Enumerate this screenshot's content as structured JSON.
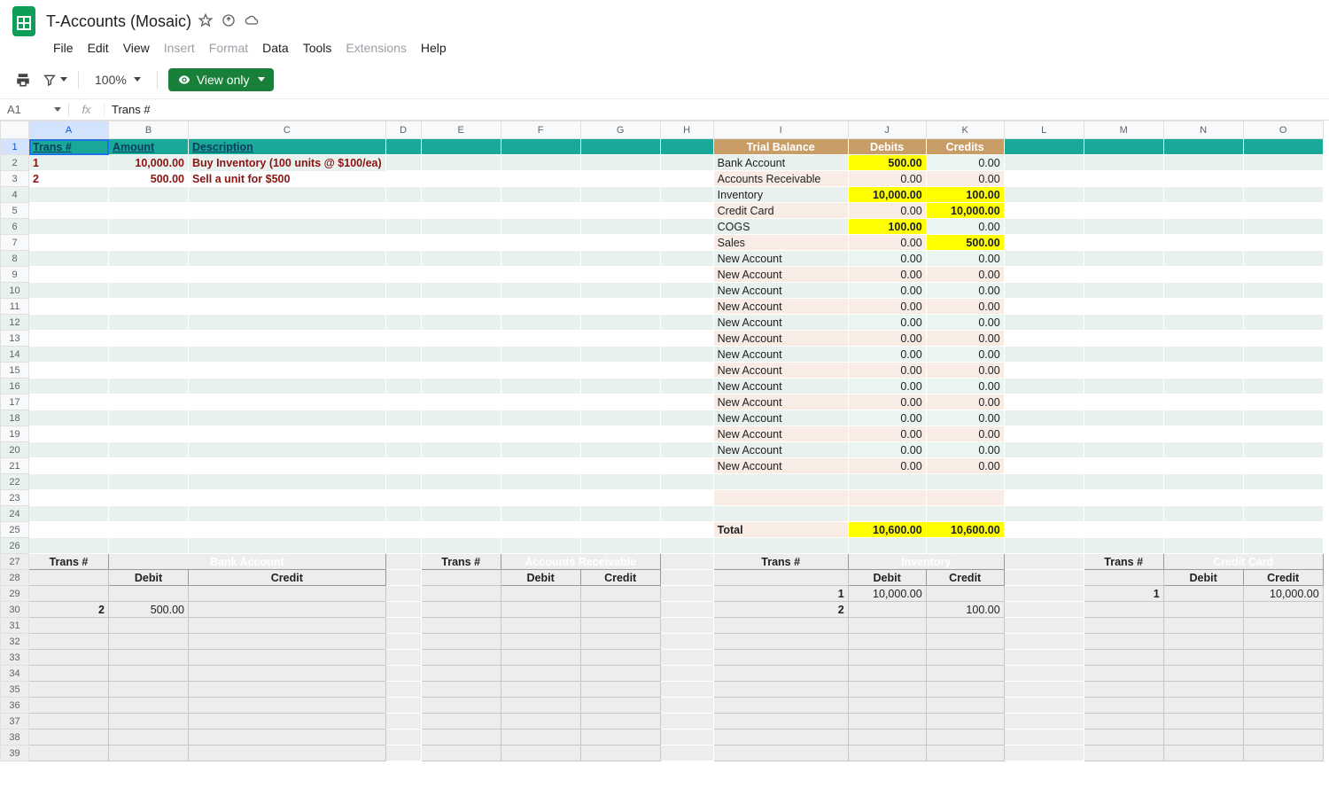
{
  "doc": {
    "title": "T-Accounts (Mosaic)"
  },
  "menus": {
    "file": "File",
    "edit": "Edit",
    "view": "View",
    "insert": "Insert",
    "format": "Format",
    "data": "Data",
    "tools": "Tools",
    "extensions": "Extensions",
    "help": "Help"
  },
  "toolbar": {
    "zoom": "100%",
    "view_only": "View only"
  },
  "formula": {
    "cell": "A1",
    "value": "Trans #"
  },
  "columns": [
    "A",
    "B",
    "C",
    "D",
    "E",
    "F",
    "G",
    "H",
    "I",
    "J",
    "K",
    "L",
    "M",
    "N",
    "O"
  ],
  "headers_row1": {
    "A": "Trans #",
    "B": "Amount",
    "C": "Description",
    "I": "Trial Balance",
    "J": "Debits",
    "K": "Credits"
  },
  "transactions": [
    {
      "num": "1",
      "amount": "10,000.00",
      "desc": "Buy Inventory (100 units @ $100/ea)"
    },
    {
      "num": "2",
      "amount": "500.00",
      "desc": "Sell a unit for $500"
    }
  ],
  "trial_balance": [
    {
      "name": "Bank Account",
      "d": "500.00",
      "c": "0.00",
      "d_y": true
    },
    {
      "name": "Accounts Receivable",
      "d": "0.00",
      "c": "0.00"
    },
    {
      "name": "Inventory",
      "d": "10,000.00",
      "c": "100.00",
      "d_y": true,
      "c_y": true
    },
    {
      "name": "Credit Card",
      "d": "0.00",
      "c": "10,000.00",
      "c_y": true
    },
    {
      "name": "COGS",
      "d": "100.00",
      "c": "0.00",
      "d_y": true
    },
    {
      "name": "Sales",
      "d": "0.00",
      "c": "500.00",
      "c_y": true
    },
    {
      "name": "New Account",
      "d": "0.00",
      "c": "0.00"
    },
    {
      "name": "New Account",
      "d": "0.00",
      "c": "0.00"
    },
    {
      "name": "New Account",
      "d": "0.00",
      "c": "0.00"
    },
    {
      "name": "New Account",
      "d": "0.00",
      "c": "0.00"
    },
    {
      "name": "New Account",
      "d": "0.00",
      "c": "0.00"
    },
    {
      "name": "New Account",
      "d": "0.00",
      "c": "0.00"
    },
    {
      "name": "New Account",
      "d": "0.00",
      "c": "0.00"
    },
    {
      "name": "New Account",
      "d": "0.00",
      "c": "0.00"
    },
    {
      "name": "New Account",
      "d": "0.00",
      "c": "0.00"
    },
    {
      "name": "New Account",
      "d": "0.00",
      "c": "0.00"
    },
    {
      "name": "New Account",
      "d": "0.00",
      "c": "0.00"
    },
    {
      "name": "New Account",
      "d": "0.00",
      "c": "0.00"
    },
    {
      "name": "New Account",
      "d": "0.00",
      "c": "0.00"
    },
    {
      "name": "New Account",
      "d": "0.00",
      "c": "0.00"
    }
  ],
  "totals": {
    "label": "Total",
    "d": "10,600.00",
    "c": "10,600.00"
  },
  "tacct_labels": {
    "trans": "Trans #",
    "debit": "Debit",
    "credit": "Credit"
  },
  "taccts": [
    {
      "title": "Bank Account",
      "rows": [
        {
          "t": "",
          "d": "",
          "c": ""
        },
        {
          "t": "2",
          "d": "500.00",
          "c": ""
        }
      ]
    },
    {
      "title": "Accounts Receivable",
      "rows": [
        {
          "t": "",
          "d": "",
          "c": ""
        },
        {
          "t": "",
          "d": "",
          "c": ""
        }
      ]
    },
    {
      "title": "Inventory",
      "rows": [
        {
          "t": "1",
          "d": "10,000.00",
          "c": ""
        },
        {
          "t": "2",
          "d": "",
          "c": "100.00"
        }
      ]
    },
    {
      "title": "Credit Card",
      "rows": [
        {
          "t": "1",
          "d": "",
          "c": "10,000.00"
        },
        {
          "t": "",
          "d": "",
          "c": ""
        }
      ]
    }
  ]
}
